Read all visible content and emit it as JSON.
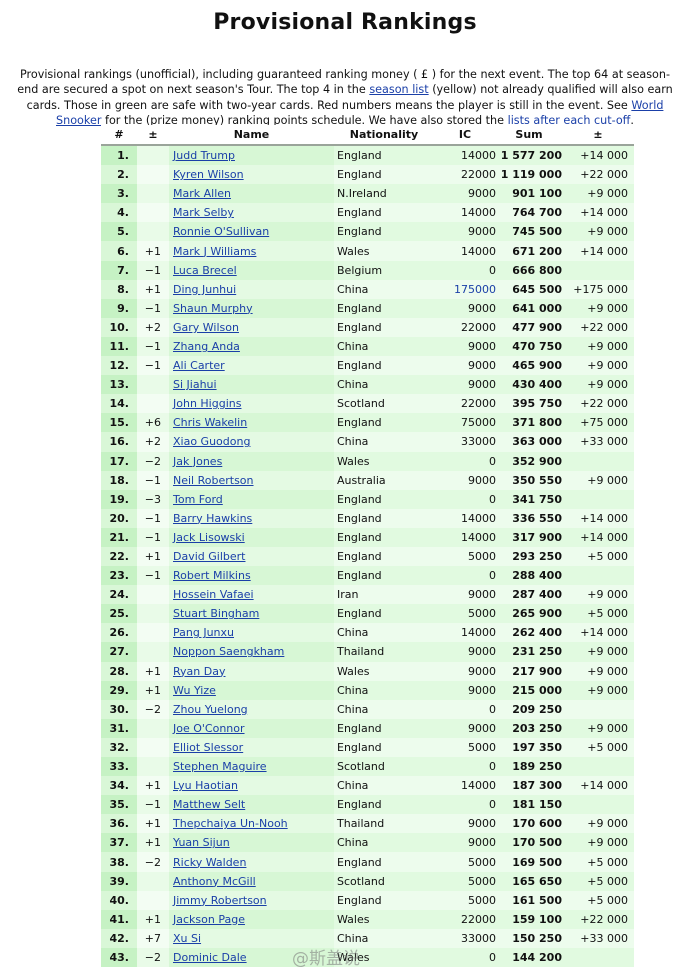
{
  "page": {
    "title": "Provisional Rankings",
    "intro": {
      "text1": "Provisional rankings (unofficial), including guaranteed ranking money ( £ ) for the next event. The top 64 at season-end are secured a spot on next season's Tour. The top 4 in the ",
      "link_season_list": "season list",
      "text2": " (yellow) not already qualified will also earn cards. Those in green are safe with two-year cards. Red numbers means the player is still in the event. See ",
      "link_world_snooker": "World Snooker",
      "text3": " for the (prize money) ranking points schedule. We have also stored the ",
      "link_cutoff_lists": "lists after each cut-off",
      "text4": "."
    }
  },
  "colors": {
    "link": "#1a3fa8",
    "rank_green": "#c6f2c4",
    "row_green": "#e1fae0",
    "in_event_blue": "#1a3fa8"
  },
  "table": {
    "headers": [
      "#",
      "±",
      "Name",
      "Nationality",
      "IC",
      "Sum",
      "±"
    ],
    "rows": [
      {
        "rank": "1.",
        "chg": "",
        "name": "Judd Trump",
        "nat": "England",
        "ic": "14000",
        "sum": "1 577 200",
        "pts": "+14 000"
      },
      {
        "rank": "2.",
        "chg": "",
        "name": "Kyren Wilson",
        "nat": "England",
        "ic": "22000",
        "sum": "1 119 000",
        "pts": "+22 000"
      },
      {
        "rank": "3.",
        "chg": "",
        "name": "Mark Allen",
        "nat": "N.Ireland",
        "ic": "9000",
        "sum": "901 100",
        "pts": "+9 000"
      },
      {
        "rank": "4.",
        "chg": "",
        "name": "Mark Selby",
        "nat": "England",
        "ic": "14000",
        "sum": "764 700",
        "pts": "+14 000"
      },
      {
        "rank": "5.",
        "chg": "",
        "name": "Ronnie O'Sullivan",
        "nat": "England",
        "ic": "9000",
        "sum": "745 500",
        "pts": "+9 000"
      },
      {
        "rank": "6.",
        "chg": "+1",
        "name": "Mark J Williams",
        "nat": "Wales",
        "ic": "14000",
        "sum": "671 200",
        "pts": "+14 000"
      },
      {
        "rank": "7.",
        "chg": "−1",
        "name": "Luca Brecel",
        "nat": "Belgium",
        "ic": "0",
        "sum": "666 800",
        "pts": ""
      },
      {
        "rank": "8.",
        "chg": "+1",
        "name": "Ding Junhui",
        "nat": "China",
        "ic": "175000",
        "sum": "645 500",
        "pts": "+175 000",
        "in_event": true
      },
      {
        "rank": "9.",
        "chg": "−1",
        "name": "Shaun Murphy",
        "nat": "England",
        "ic": "9000",
        "sum": "641 000",
        "pts": "+9 000"
      },
      {
        "rank": "10.",
        "chg": "+2",
        "name": "Gary Wilson",
        "nat": "England",
        "ic": "22000",
        "sum": "477 900",
        "pts": "+22 000"
      },
      {
        "rank": "11.",
        "chg": "−1",
        "name": "Zhang Anda",
        "nat": "China",
        "ic": "9000",
        "sum": "470 750",
        "pts": "+9 000"
      },
      {
        "rank": "12.",
        "chg": "−1",
        "name": "Ali Carter",
        "nat": "England",
        "ic": "9000",
        "sum": "465 900",
        "pts": "+9 000"
      },
      {
        "rank": "13.",
        "chg": "",
        "name": "Si Jiahui",
        "nat": "China",
        "ic": "9000",
        "sum": "430 400",
        "pts": "+9 000"
      },
      {
        "rank": "14.",
        "chg": "",
        "name": "John Higgins",
        "nat": "Scotland",
        "ic": "22000",
        "sum": "395 750",
        "pts": "+22 000"
      },
      {
        "rank": "15.",
        "chg": "+6",
        "name": "Chris Wakelin",
        "nat": "England",
        "ic": "75000",
        "sum": "371 800",
        "pts": "+75 000"
      },
      {
        "rank": "16.",
        "chg": "+2",
        "name": "Xiao Guodong",
        "nat": "China",
        "ic": "33000",
        "sum": "363 000",
        "pts": "+33 000"
      },
      {
        "rank": "17.",
        "chg": "−2",
        "name": "Jak Jones",
        "nat": "Wales",
        "ic": "0",
        "sum": "352 900",
        "pts": ""
      },
      {
        "rank": "18.",
        "chg": "−1",
        "name": "Neil Robertson",
        "nat": "Australia",
        "ic": "9000",
        "sum": "350 550",
        "pts": "+9 000"
      },
      {
        "rank": "19.",
        "chg": "−3",
        "name": "Tom Ford",
        "nat": "England",
        "ic": "0",
        "sum": "341 750",
        "pts": ""
      },
      {
        "rank": "20.",
        "chg": "−1",
        "name": "Barry Hawkins",
        "nat": "England",
        "ic": "14000",
        "sum": "336 550",
        "pts": "+14 000"
      },
      {
        "rank": "21.",
        "chg": "−1",
        "name": "Jack Lisowski",
        "nat": "England",
        "ic": "14000",
        "sum": "317 900",
        "pts": "+14 000"
      },
      {
        "rank": "22.",
        "chg": "+1",
        "name": "David Gilbert",
        "nat": "England",
        "ic": "5000",
        "sum": "293 250",
        "pts": "+5 000"
      },
      {
        "rank": "23.",
        "chg": "−1",
        "name": "Robert Milkins",
        "nat": "England",
        "ic": "0",
        "sum": "288 400",
        "pts": ""
      },
      {
        "rank": "24.",
        "chg": "",
        "name": "Hossein Vafaei",
        "nat": "Iran",
        "ic": "9000",
        "sum": "287 400",
        "pts": "+9 000"
      },
      {
        "rank": "25.",
        "chg": "",
        "name": "Stuart Bingham",
        "nat": "England",
        "ic": "5000",
        "sum": "265 900",
        "pts": "+5 000"
      },
      {
        "rank": "26.",
        "chg": "",
        "name": "Pang Junxu",
        "nat": "China",
        "ic": "14000",
        "sum": "262 400",
        "pts": "+14 000"
      },
      {
        "rank": "27.",
        "chg": "",
        "name": "Noppon Saengkham",
        "nat": "Thailand",
        "ic": "9000",
        "sum": "231 250",
        "pts": "+9 000"
      },
      {
        "rank": "28.",
        "chg": "+1",
        "name": "Ryan Day",
        "nat": "Wales",
        "ic": "9000",
        "sum": "217 900",
        "pts": "+9 000"
      },
      {
        "rank": "29.",
        "chg": "+1",
        "name": "Wu Yize",
        "nat": "China",
        "ic": "9000",
        "sum": "215 000",
        "pts": "+9 000"
      },
      {
        "rank": "30.",
        "chg": "−2",
        "name": "Zhou Yuelong",
        "nat": "China",
        "ic": "0",
        "sum": "209 250",
        "pts": ""
      },
      {
        "rank": "31.",
        "chg": "",
        "name": "Joe O'Connor",
        "nat": "England",
        "ic": "9000",
        "sum": "203 250",
        "pts": "+9 000"
      },
      {
        "rank": "32.",
        "chg": "",
        "name": "Elliot Slessor",
        "nat": "England",
        "ic": "5000",
        "sum": "197 350",
        "pts": "+5 000"
      },
      {
        "rank": "33.",
        "chg": "",
        "name": "Stephen Maguire",
        "nat": "Scotland",
        "ic": "0",
        "sum": "189 250",
        "pts": ""
      },
      {
        "rank": "34.",
        "chg": "+1",
        "name": "Lyu Haotian",
        "nat": "China",
        "ic": "14000",
        "sum": "187 300",
        "pts": "+14 000"
      },
      {
        "rank": "35.",
        "chg": "−1",
        "name": "Matthew Selt",
        "nat": "England",
        "ic": "0",
        "sum": "181 150",
        "pts": ""
      },
      {
        "rank": "36.",
        "chg": "+1",
        "name": "Thepchaiya Un-Nooh",
        "nat": "Thailand",
        "ic": "9000",
        "sum": "170 600",
        "pts": "+9 000"
      },
      {
        "rank": "37.",
        "chg": "+1",
        "name": "Yuan Sijun",
        "nat": "China",
        "ic": "9000",
        "sum": "170 500",
        "pts": "+9 000"
      },
      {
        "rank": "38.",
        "chg": "−2",
        "name": "Ricky Walden",
        "nat": "England",
        "ic": "5000",
        "sum": "169 500",
        "pts": "+5 000"
      },
      {
        "rank": "39.",
        "chg": "",
        "name": "Anthony McGill",
        "nat": "Scotland",
        "ic": "5000",
        "sum": "165 650",
        "pts": "+5 000"
      },
      {
        "rank": "40.",
        "chg": "",
        "name": "Jimmy Robertson",
        "nat": "England",
        "ic": "5000",
        "sum": "161 500",
        "pts": "+5 000"
      },
      {
        "rank": "41.",
        "chg": "+1",
        "name": "Jackson Page",
        "nat": "Wales",
        "ic": "22000",
        "sum": "159 100",
        "pts": "+22 000"
      },
      {
        "rank": "42.",
        "chg": "+7",
        "name": "Xu Si",
        "nat": "China",
        "ic": "33000",
        "sum": "150 250",
        "pts": "+33 000"
      },
      {
        "rank": "43.",
        "chg": "−2",
        "name": "Dominic Dale",
        "nat": "Wales",
        "ic": "0",
        "sum": "144 200",
        "pts": ""
      }
    ]
  },
  "watermark": "@斯盖说"
}
